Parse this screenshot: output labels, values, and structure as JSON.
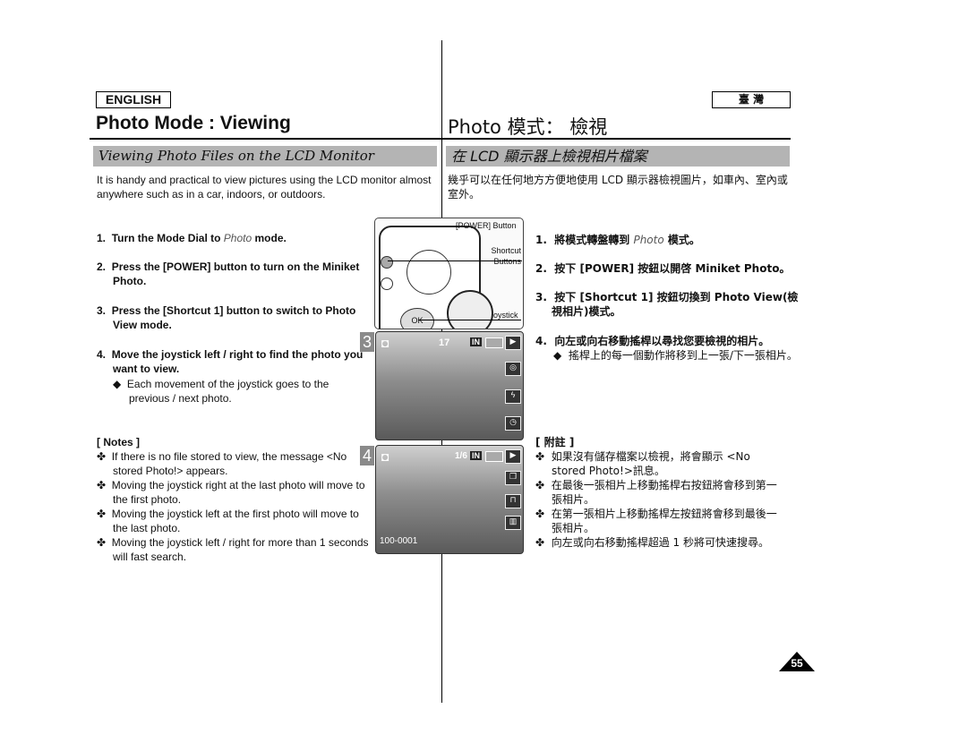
{
  "left": {
    "language": "ENGLISH",
    "title": "Photo Mode : Viewing",
    "section": "Viewing Photo Files on the LCD Monitor",
    "intro": "It is handy and practical to view pictures using the LCD monitor almost anywhere such as in a car, indoors, or outdoors.",
    "steps": [
      {
        "n": "1.",
        "pre": "Turn the Mode Dial to ",
        "em": "Photo",
        "post": " mode."
      },
      {
        "n": "2.",
        "text": "Press the [POWER] button to turn on the Miniket Photo."
      },
      {
        "n": "3.",
        "text": "Press the [Shortcut 1] button to switch to Photo View mode."
      },
      {
        "n": "4.",
        "text": "Move the joystick left / right to find the photo you want to view."
      }
    ],
    "step4_bullet": "Each movement of the joystick goes to the previous / next photo.",
    "notes_title": "[ Notes ]",
    "notes": [
      "If there is no file stored to view, the message <No stored Photo!> appears.",
      "Moving the joystick right at the last photo will move to the first photo.",
      "Moving the joystick left at the first photo will move to the last photo.",
      "Moving the joystick left / right for more than 1 seconds will fast search."
    ]
  },
  "right": {
    "language": "臺 灣",
    "title": "Photo 模式： 檢視",
    "section": "在 LCD 顯示器上檢視相片檔案",
    "intro": "幾乎可以在任何地方方便地使用 LCD 顯示器檢視圖片，如車內、室內或室外。",
    "steps": [
      {
        "n": "1.",
        "pre": "將模式轉盤轉到 ",
        "em": "Photo",
        "post": " 模式。"
      },
      {
        "n": "2.",
        "text": "按下 [POWER] 按鈕以開啓 Miniket Photo。"
      },
      {
        "n": "3.",
        "text": "按下 [Shortcut 1] 按鈕切換到 Photo View(檢視相片)模式。"
      },
      {
        "n": "4.",
        "text": "向左或向右移動搖桿以尋找您要檢視的相片。"
      }
    ],
    "step4_bullet": "搖桿上的每一個動作將移到上一張/下一張相片。",
    "notes_title": "[ 附註 ]",
    "notes": [
      "如果沒有儲存檔案以檢視，將會顯示 <No stored Photo!>訊息。",
      "在最後一張相片上移動搖桿右按鈕將會移到第一張相片。",
      "在第一張相片上移動搖桿左按鈕將會移到最後一張相片。",
      "向左或向右移動搖桿超過 1 秒將可快速搜尋。"
    ]
  },
  "figure": {
    "labels": {
      "power": "[POWER] Button",
      "shortcut": "Shortcut Buttons",
      "joystick": "joystick",
      "ok": "OK"
    },
    "screen3": {
      "step": "3",
      "counter": "17",
      "memory": "IN"
    },
    "screen4": {
      "step": "4",
      "counter": "1/6",
      "memory": "IN",
      "file": "100-0001"
    }
  },
  "page_number": "55"
}
